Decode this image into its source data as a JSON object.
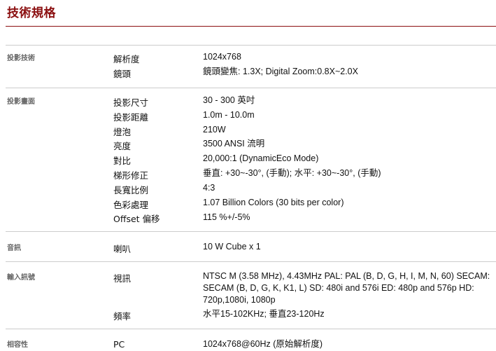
{
  "page_title": "技術規格",
  "sections": [
    {
      "category": "投影技術",
      "rows": [
        {
          "label": "解析度",
          "value": "1024x768"
        },
        {
          "label": "鏡頭",
          "value": "鏡頭變焦: 1.3X; Digital Zoom:0.8X~2.0X"
        }
      ]
    },
    {
      "category": "投影畫面",
      "rows": [
        {
          "label": "投影尺寸",
          "value": "30 - 300 英吋"
        },
        {
          "label": "投影距離",
          "value": "1.0m - 10.0m"
        },
        {
          "label": "燈泡",
          "value": "210W"
        },
        {
          "label": "亮度",
          "value": "3500 ANSI 流明"
        },
        {
          "label": "對比",
          "value": "20,000:1 (DynamicEco Mode)"
        },
        {
          "label": "梯形修正",
          "value": "垂直: +30~-30°, (手動); 水平: +30~-30°, (手動)"
        },
        {
          "label": "長寬比例",
          "value": "4:3"
        },
        {
          "label": "色彩處理",
          "value": "1.07 Billion Colors (30 bits per color)"
        },
        {
          "label": "Offset 偏移",
          "value": "115 %+/-5%"
        }
      ]
    },
    {
      "category": "音訊",
      "rows": [
        {
          "label": "喇叭",
          "value": "10 W Cube x 1"
        }
      ]
    },
    {
      "category": "輸入訊號",
      "rows": [
        {
          "label": "視訊",
          "value": "NTSC M (3.58 MHz), 4.43MHz PAL: PAL (B, D, G, H, I, M, N, 60) SECAM: SECAM (B, D, G, K, K1, L) SD: 480i and 576i ED: 480p and 576p HD: 720p,1080i, 1080p"
        },
        {
          "label": "頻率",
          "value": "水平15-102KHz; 垂直23-120Hz"
        }
      ]
    },
    {
      "category": "相容性",
      "rows": [
        {
          "label": "PC",
          "value": "1024x768@60Hz (原始解析度)"
        }
      ]
    }
  ]
}
